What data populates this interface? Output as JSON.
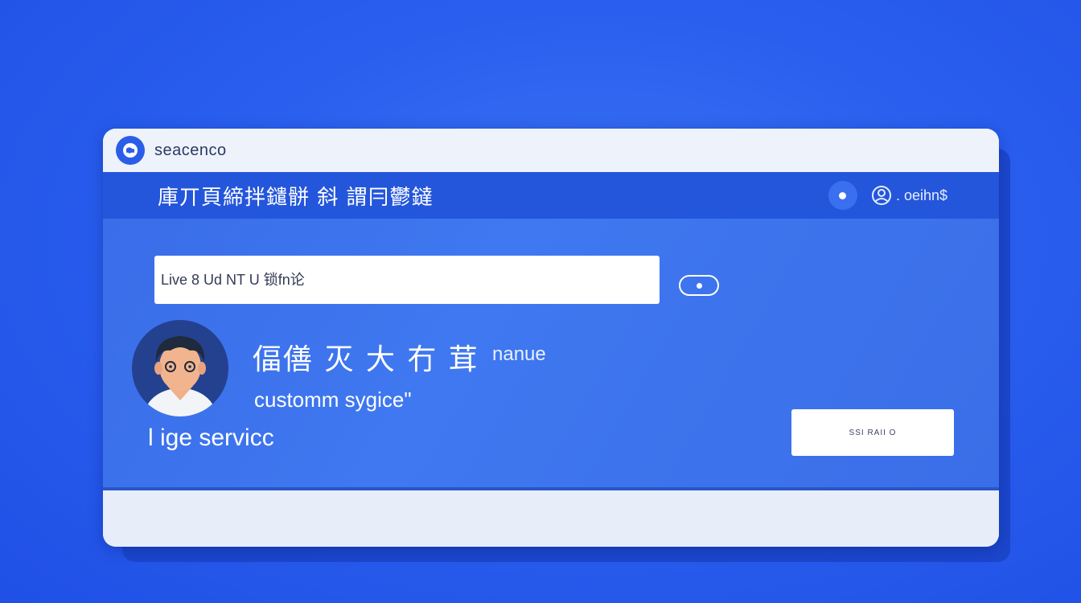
{
  "app": {
    "name": "seacenco",
    "logo_icon": "globe-logo-icon"
  },
  "header": {
    "title": "庫丌頁締拌鑓骿 斜 謂冃鬱鐽",
    "account_label": ". oeihn$",
    "account_icon": "user-circle-icon"
  },
  "search": {
    "placeholder": "Live 8 Ud NT U 锁fn论"
  },
  "agent": {
    "name": "偪僐 灭 大 冇 茸",
    "name_tag": "nanue",
    "role": "customm sygice\"",
    "avatar_icon": "agent-avatar"
  },
  "service": {
    "label": "l ige servicc"
  },
  "actions": {
    "primary_label": "SSI RAII O"
  },
  "colors": {
    "background": "#2a5fee",
    "header_bar": "#2456dc",
    "panel": "#3f78f0",
    "window": "#eaf0fa"
  }
}
